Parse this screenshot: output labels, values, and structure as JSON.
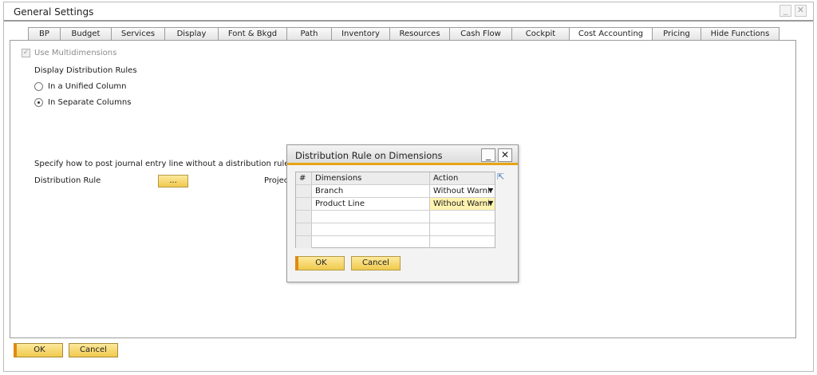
{
  "window": {
    "title": "General Settings",
    "minimize_glyph": "_",
    "close_glyph": "✕"
  },
  "tabs": [
    {
      "label": "BP"
    },
    {
      "label": "Budget"
    },
    {
      "label": "Services"
    },
    {
      "label": "Display"
    },
    {
      "label": "Font & Bkgd"
    },
    {
      "label": "Path"
    },
    {
      "label": "Inventory"
    },
    {
      "label": "Resources"
    },
    {
      "label": "Cash Flow"
    },
    {
      "label": "Cockpit"
    },
    {
      "label": "Cost Accounting",
      "active": true
    },
    {
      "label": "Pricing"
    },
    {
      "label": "Hide Functions"
    }
  ],
  "cost_accounting": {
    "use_multidimensions_label": "Use Multidimensions",
    "use_multidimensions_checked": true,
    "display_rules_label": "Display Distribution Rules",
    "option_unified": "In a Unified Column",
    "option_separate": "In Separate Columns",
    "selected_option": "In Separate Columns",
    "specify_text": "Specify how to post journal entry line without a distribution rule or proje",
    "distribution_rule_label": "Distribution Rule",
    "browse_label": "...",
    "project_label": "Projec"
  },
  "footer": {
    "ok_label": "OK",
    "cancel_label": "Cancel"
  },
  "dialog": {
    "title": "Distribution Rule on Dimensions",
    "minimize_glyph": "_",
    "close_glyph": "✕",
    "columns": [
      "#",
      "Dimensions",
      "Action"
    ],
    "rows": [
      {
        "num": "",
        "dimension": "Branch",
        "action": "Without Warnir"
      },
      {
        "num": "",
        "dimension": "Product Line",
        "action": "Without Warnir"
      },
      {
        "num": "",
        "dimension": "",
        "action": ""
      },
      {
        "num": "",
        "dimension": "",
        "action": ""
      },
      {
        "num": "",
        "dimension": "",
        "action": ""
      }
    ],
    "ok_label": "OK",
    "cancel_label": "Cancel"
  },
  "colors": {
    "accent_orange": "#e8a317",
    "button_yellow": "#f0c94d",
    "selected_row": "#fff3b0"
  }
}
